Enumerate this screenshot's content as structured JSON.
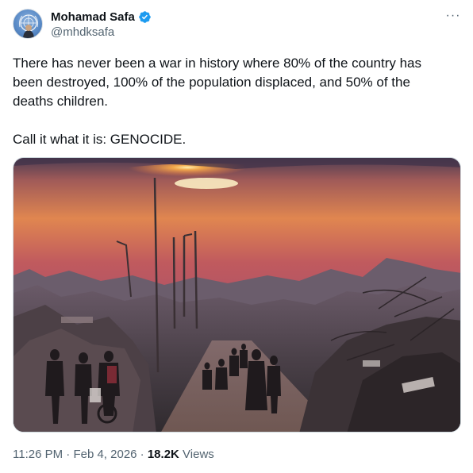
{
  "author": {
    "display_name": "Mohamad Safa",
    "handle": "@mhdksafa",
    "verified": true,
    "avatar_icon": "un-emblem-avatar"
  },
  "menu": {
    "more_label": "···"
  },
  "tweet": {
    "paragraphs": [
      "There has never been a war in history where 80% of the country has been destroyed, 100% of the population displaced, and 50% of the deaths children.",
      "Call it what it is: GENOCIDE."
    ]
  },
  "footer": {
    "time": "11:26 PM",
    "separator": " · ",
    "date": "Feb 4, 2026",
    "views_count": "18.2K",
    "views_label": " Views"
  },
  "colors": {
    "text_primary": "#0f1419",
    "text_secondary": "#536471",
    "verified_blue": "#1d9bf0",
    "media_border": "#cfd9de"
  }
}
